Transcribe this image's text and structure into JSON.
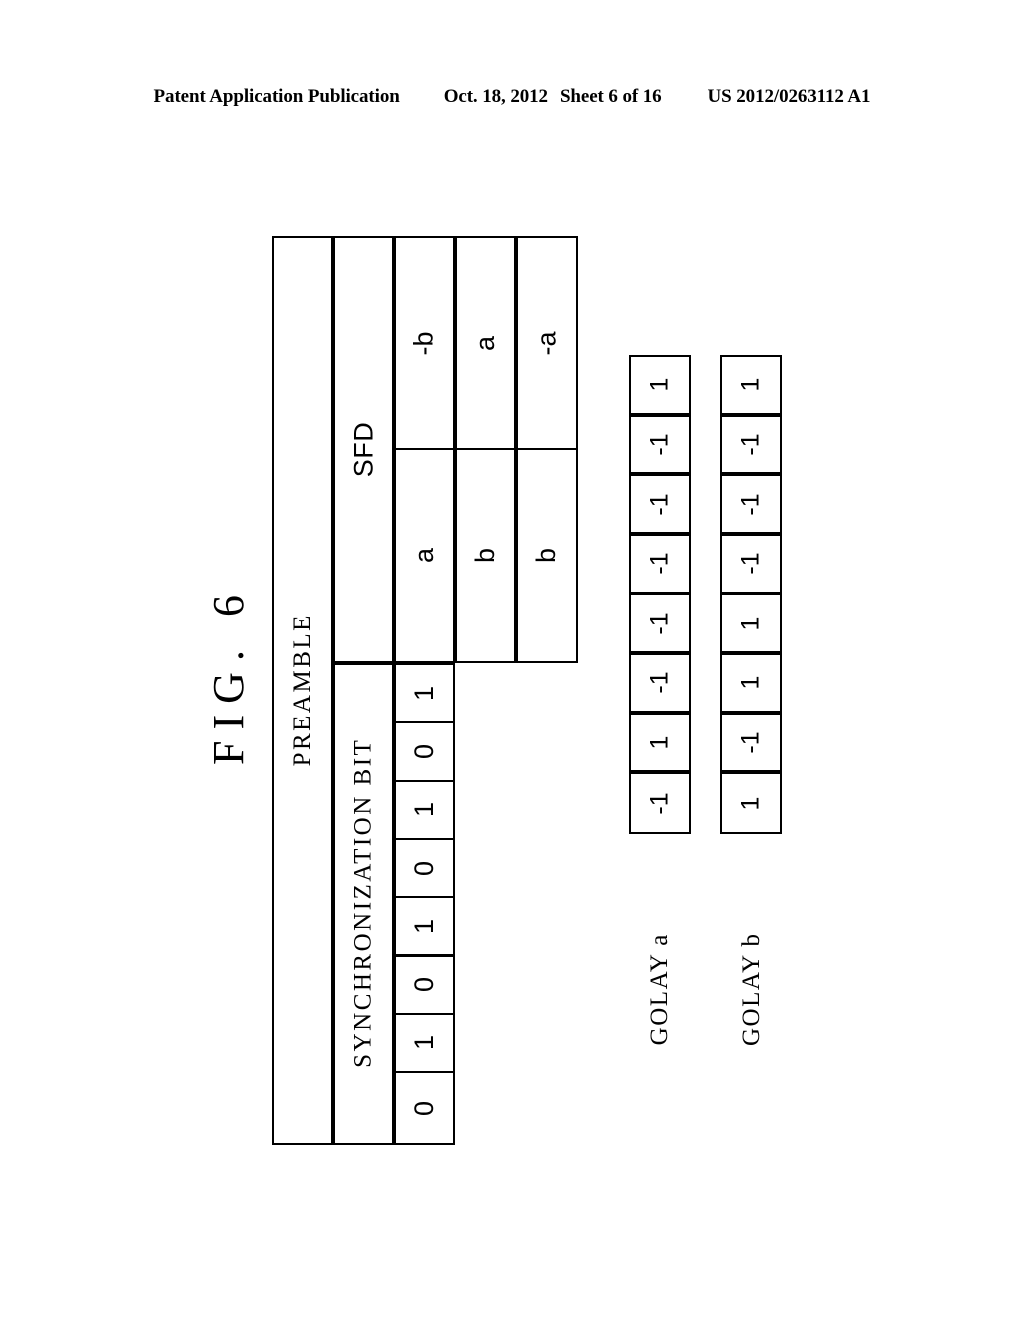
{
  "page_header": {
    "publication": "Patent Application Publication",
    "date": "Oct. 18, 2012",
    "sheet": "Sheet 6 of 16",
    "document_number": "US 2012/0263112 A1"
  },
  "figure": {
    "label": "FIG. 6"
  },
  "frame_diagram": {
    "preamble_label": "PREAMBLE",
    "sfd_label": "SFD",
    "sync_label": "SYNCHRONIZATION BIT",
    "sync_bits": [
      "0",
      "1",
      "0",
      "1",
      "0",
      "1",
      "0",
      "1"
    ],
    "sfd_rows": [
      [
        "a",
        "-b"
      ],
      [
        "b",
        "a"
      ],
      [
        "b",
        "-a"
      ]
    ]
  },
  "golay": {
    "sequences": [
      {
        "name": "GOLAY a",
        "values": [
          "-1",
          "1",
          "-1",
          "-1",
          "-1",
          "-1",
          "-1",
          "1"
        ]
      },
      {
        "name": "GOLAY b",
        "values": [
          "1",
          "-1",
          "1",
          "1",
          "-1",
          "-1",
          "-1",
          "1"
        ]
      }
    ]
  },
  "colors": {
    "ink": "#000000",
    "paper": "#ffffff"
  }
}
